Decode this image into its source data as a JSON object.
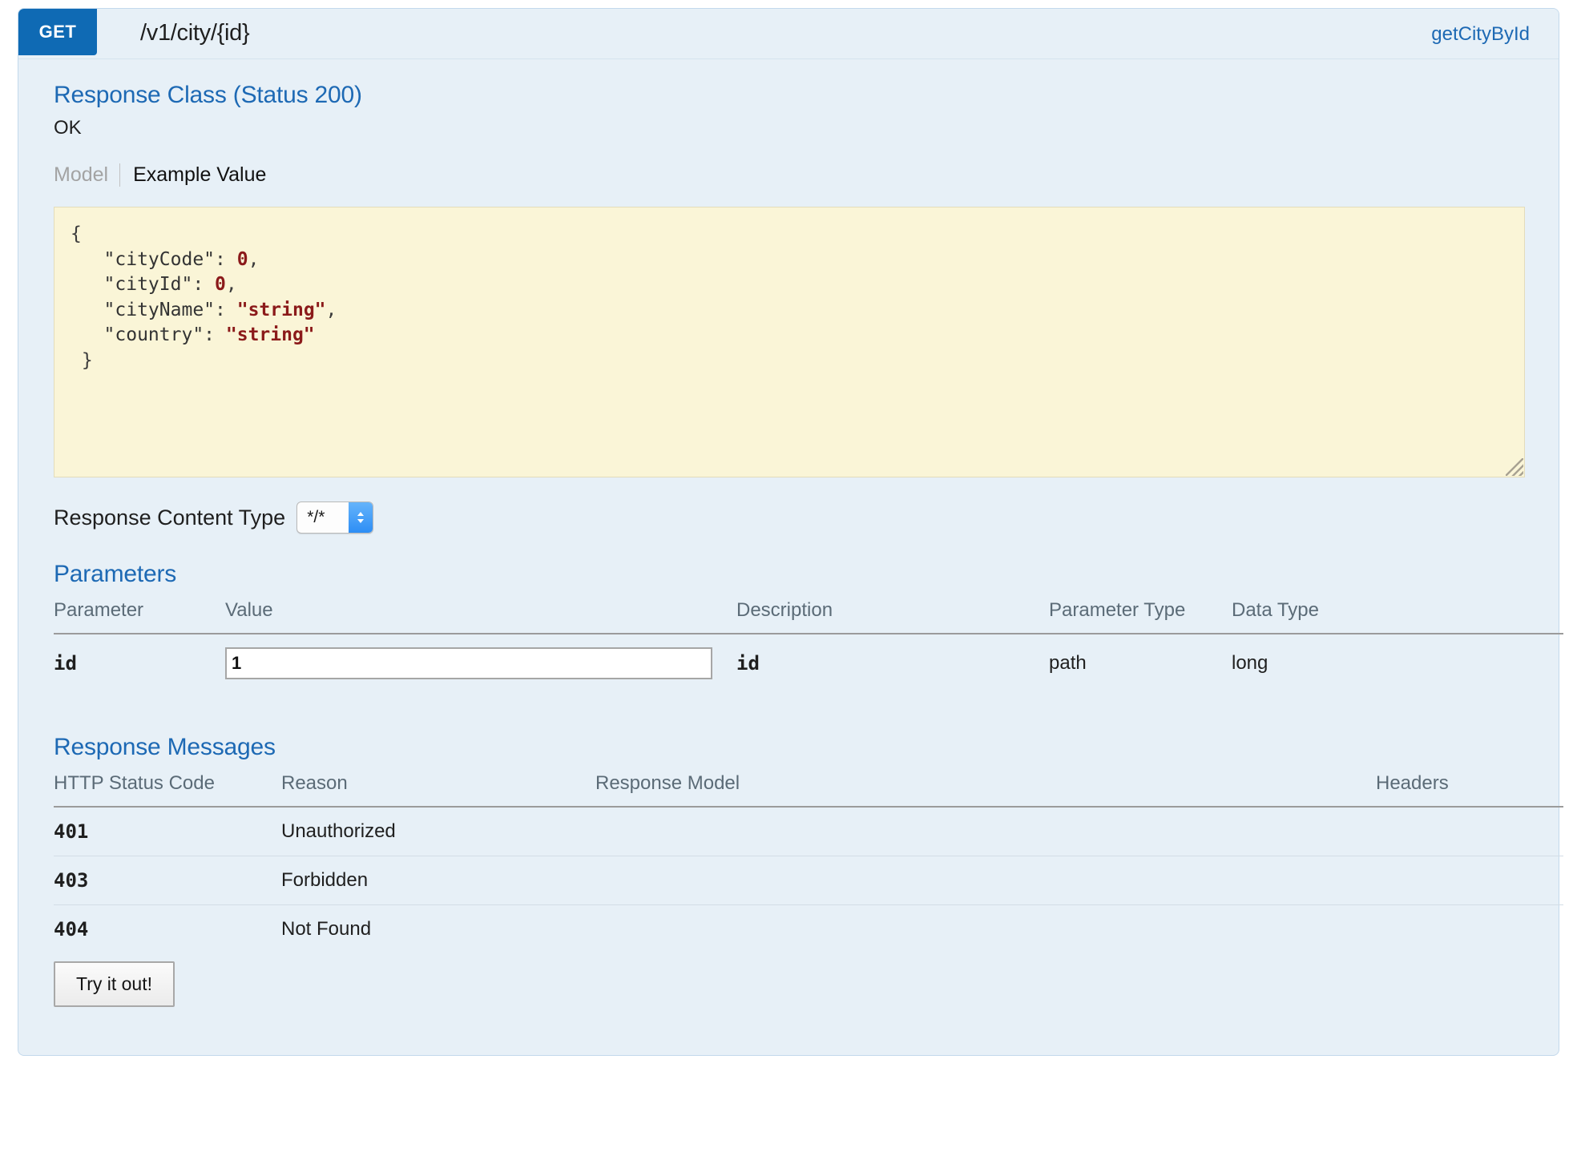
{
  "operation": {
    "method": "GET",
    "path": "/v1/city/{id}",
    "nickname": "getCityById",
    "method_color": "#0f6ab4",
    "accent_color": "#1d69b4"
  },
  "response_class": {
    "title": "Response Class (Status 200)",
    "status_text": "OK",
    "tabs": {
      "model_label": "Model",
      "example_label": "Example Value"
    },
    "example_value": {
      "open_brace": "{",
      "close_brace": "}",
      "fields": [
        {
          "key": "\"cityCode\"",
          "sep": ": ",
          "value": "0",
          "value_kind": "number",
          "comma": ","
        },
        {
          "key": "\"cityId\"",
          "sep": ": ",
          "value": "0",
          "value_kind": "number",
          "comma": ","
        },
        {
          "key": "\"cityName\"",
          "sep": ": ",
          "value": "\"string\"",
          "value_kind": "string",
          "comma": ","
        },
        {
          "key": "\"country\"",
          "sep": ": ",
          "value": "\"string\"",
          "value_kind": "string",
          "comma": ""
        }
      ],
      "raw": "{\n   \"cityCode\": 0,\n   \"cityId\": 0,\n   \"cityName\": \"string\",\n   \"country\": \"string\"\n}"
    }
  },
  "content_type": {
    "label": "Response Content Type",
    "selected": "*/*",
    "options": [
      "*/*"
    ]
  },
  "parameters": {
    "title": "Parameters",
    "columns": [
      "Parameter",
      "Value",
      "Description",
      "Parameter Type",
      "Data Type"
    ],
    "rows": [
      {
        "parameter": "id",
        "value": "1",
        "value_placeholder": "",
        "description": "id",
        "parameter_type": "path",
        "data_type": "long"
      }
    ]
  },
  "response_messages": {
    "title": "Response Messages",
    "columns": [
      "HTTP Status Code",
      "Reason",
      "Response Model",
      "Headers"
    ],
    "rows": [
      {
        "status": "401",
        "reason": "Unauthorized",
        "model": "",
        "headers": ""
      },
      {
        "status": "403",
        "reason": "Forbidden",
        "model": "",
        "headers": ""
      },
      {
        "status": "404",
        "reason": "Not Found",
        "model": "",
        "headers": ""
      }
    ]
  },
  "actions": {
    "try_it_out_label": "Try it out!"
  }
}
